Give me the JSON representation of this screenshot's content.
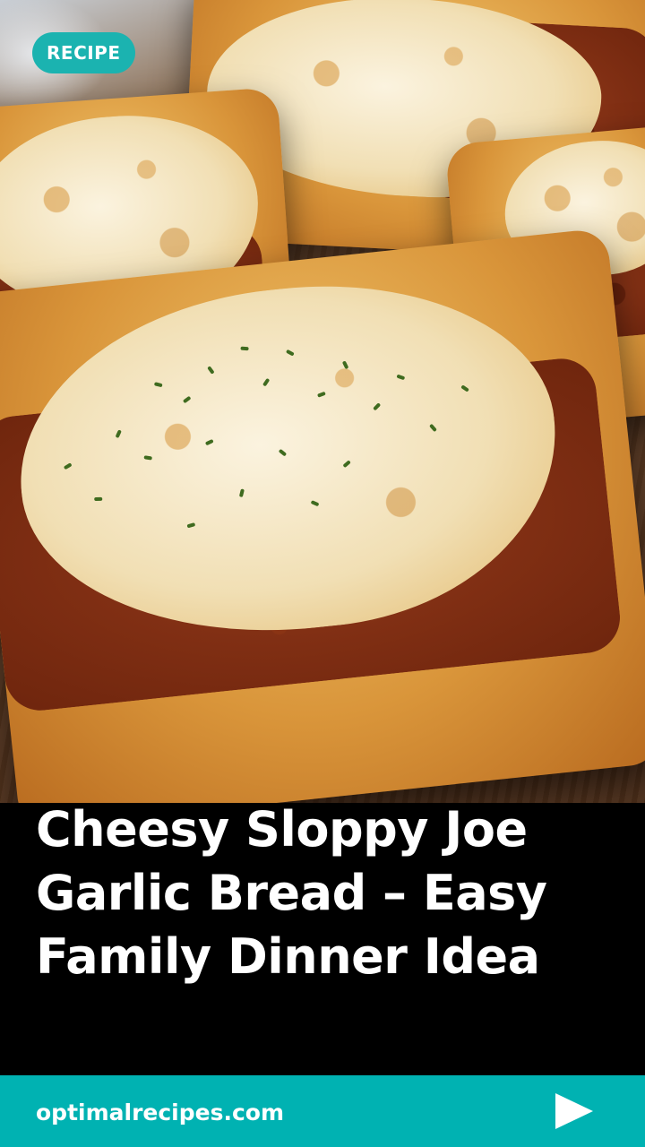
{
  "badge": {
    "label": "RECIPE"
  },
  "hero": {
    "image_description_icon": "food-photo"
  },
  "title": {
    "text": "Cheesy Sloppy Joe Garlic Bread – Easy Family Dinner Idea"
  },
  "footer": {
    "site": "optimalrecipes.com",
    "next_icon": "play-arrow-icon"
  },
  "colors": {
    "accent": "#00b2b2",
    "badge": "#1bb3b0",
    "background": "#000000",
    "text": "#ffffff"
  }
}
